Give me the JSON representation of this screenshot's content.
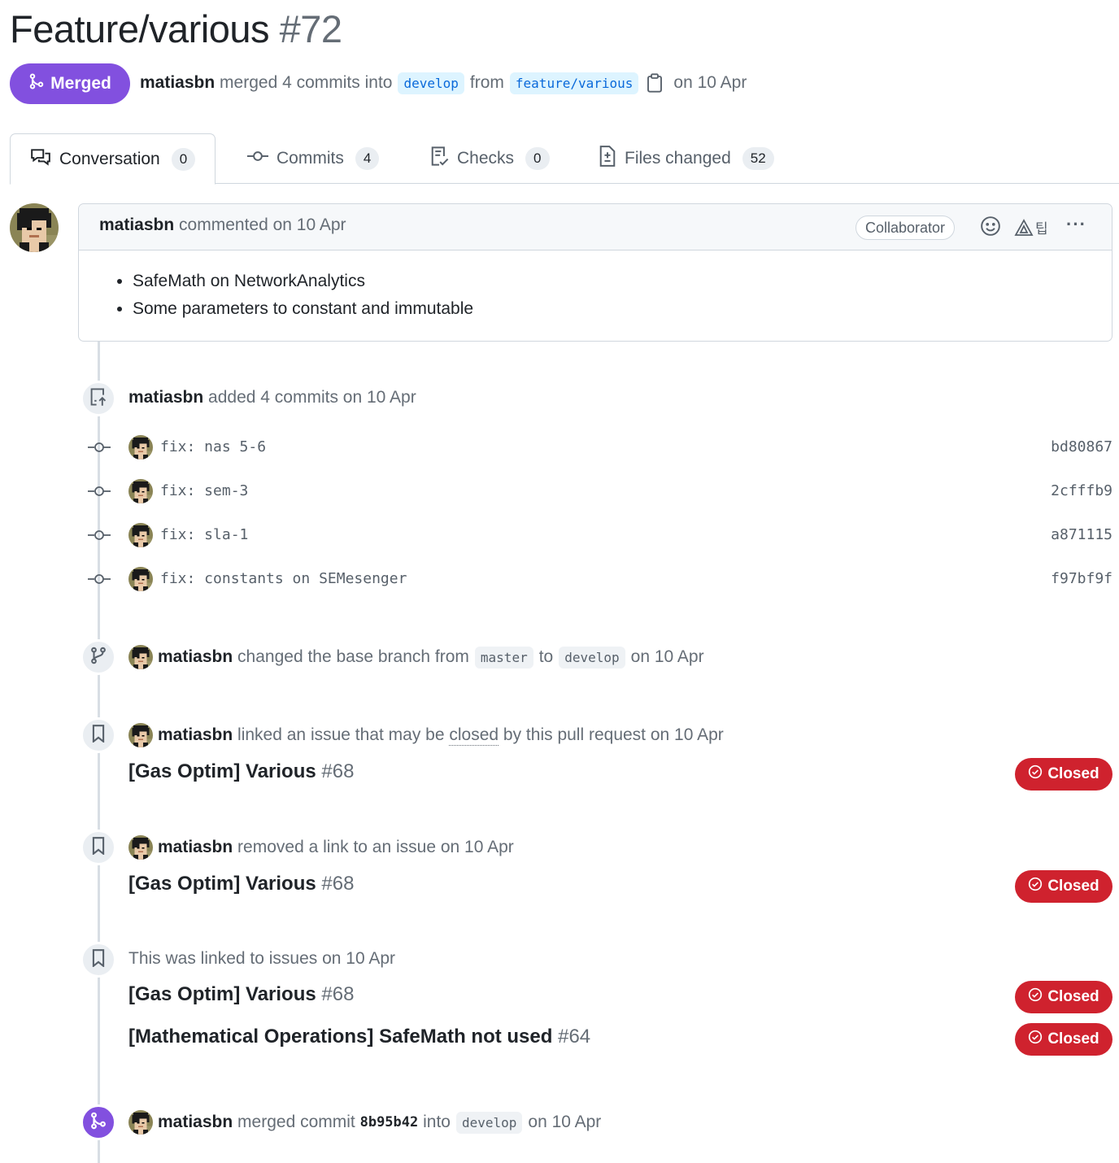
{
  "pr": {
    "title": "Feature/various",
    "number": "#72",
    "status": "Merged",
    "author": "matiasbn",
    "merged_text": "merged 4 commits into",
    "base_branch": "develop",
    "from_text": "from",
    "head_branch": "feature/various",
    "date_text": "on 10 Apr"
  },
  "tabs": [
    {
      "label": "Conversation",
      "count": "0"
    },
    {
      "label": "Commits",
      "count": "4"
    },
    {
      "label": "Checks",
      "count": "0"
    },
    {
      "label": "Files changed",
      "count": "52"
    }
  ],
  "comment": {
    "author": "matiasbn",
    "meta": "commented on 10 Apr",
    "role": "Collaborator",
    "extra_glyph": "팁",
    "bullets": [
      "SafeMath on NetworkAnalytics",
      "Some parameters to constant and immutable"
    ]
  },
  "timeline": {
    "commits_event": {
      "author": "matiasbn",
      "text": "added 4 commits on 10 Apr"
    },
    "commits": [
      {
        "message": "fix: nas 5-6",
        "sha": "bd80867"
      },
      {
        "message": "fix: sem-3",
        "sha": "2cfffb9"
      },
      {
        "message": "fix: sla-1",
        "sha": "a871115"
      },
      {
        "message": "fix: constants on SEMesenger",
        "sha": "f97bf9f"
      }
    ],
    "base_change": {
      "author": "matiasbn",
      "text": "changed the base branch from",
      "from": "master",
      "to_text": "to",
      "to": "develop",
      "date": "on 10 Apr"
    },
    "linked": {
      "author": "matiasbn",
      "text1": "linked an issue that may be",
      "closed_word": "closed",
      "text2": "by this pull request on 10 Apr",
      "issue_title": "[Gas Optim] Various",
      "issue_num": "#68",
      "badge": "Closed"
    },
    "removed": {
      "author": "matiasbn",
      "text": "removed a link to an issue on 10 Apr",
      "issue_title": "[Gas Optim] Various",
      "issue_num": "#68",
      "badge": "Closed"
    },
    "was_linked": {
      "text": "This was linked to issues on 10 Apr",
      "issues": [
        {
          "title": "[Gas Optim] Various",
          "num": "#68",
          "badge": "Closed"
        },
        {
          "title": "[Mathematical Operations] SafeMath not used",
          "num": "#64",
          "badge": "Closed"
        }
      ]
    },
    "merged": {
      "author": "matiasbn",
      "text": "merged commit",
      "sha": "8b95b42",
      "into": "into",
      "branch": "develop",
      "date": "on 10 Apr"
    }
  },
  "colors": {
    "merged_purple": "#8250df",
    "closed_red": "#cf222e",
    "link_blue": "#0969da"
  }
}
